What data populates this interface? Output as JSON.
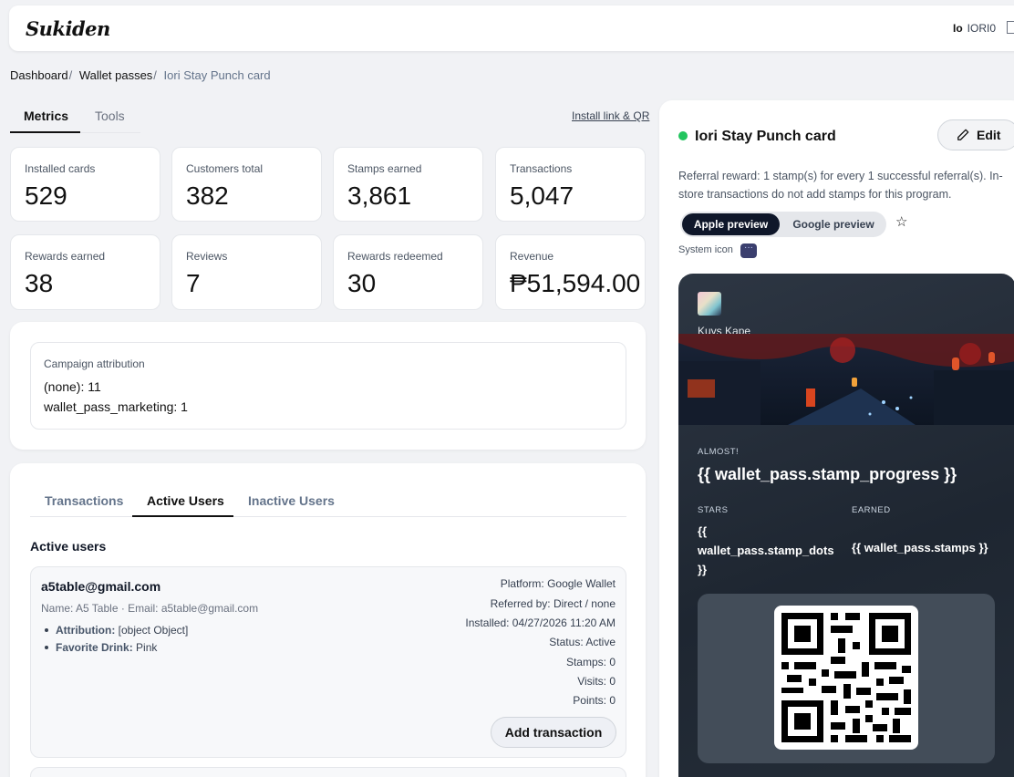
{
  "app": {
    "logo": "Sukiden"
  },
  "user": {
    "initials": "Io",
    "name": "IORI0"
  },
  "breadcrumb": {
    "dashboard": "Dashboard",
    "wallet_passes": "Wallet passes",
    "current": "Iori Stay Punch card",
    "sep": "/"
  },
  "tabs": {
    "metrics": "Metrics",
    "tools": "Tools"
  },
  "install_link": "Install link & QR",
  "metrics": {
    "installed_label": "Installed cards",
    "installed_value": "529",
    "customers_label": "Customers total",
    "customers_value": "382",
    "stamps_label": "Stamps earned",
    "stamps_value": "3,861",
    "transactions_label": "Transactions",
    "transactions_value": "5,047",
    "rewards_label": "Rewards earned",
    "rewards_value": "38",
    "reviews_label": "Reviews",
    "reviews_value": "7",
    "redeemed_label": "Rewards redeemed",
    "redeemed_value": "30",
    "revenue_label": "Revenue",
    "revenue_value": "₱51,594.00"
  },
  "attribution": {
    "title": "Campaign attribution",
    "line1": "(none): 11",
    "line2": "wallet_pass_marketing: 1"
  },
  "user_tabs": {
    "transactions": "Transactions",
    "active": "Active Users",
    "inactive": "Inactive Users"
  },
  "active_users": {
    "title": "Active users",
    "user1": {
      "email": "a5table@gmail.com",
      "sub": "Name: A5 Table · Email: a5table@gmail.com",
      "attr_key": "Attribution:",
      "attr_val": " [object Object]",
      "drink_key": "Favorite Drink:",
      "drink_val": " Pink",
      "platform": "Platform: Google Wallet",
      "referred": "Referred by: Direct / none",
      "installed": "Installed: 04/27/2026 11:20 AM",
      "status": "Status: Active",
      "stamps": "Stamps: 0",
      "visits": "Visits: 0",
      "points": "Points: 0",
      "add_btn": "Add transaction"
    }
  },
  "preview": {
    "title": "Iori Stay Punch card",
    "edit": "Edit",
    "referral": "Referral reward: 1 stamp(s) for every 1 successful referral(s). In-store transactions do not add stamps for this program.",
    "apple": "Apple preview",
    "google": "Google preview",
    "system_icon": "System icon",
    "status_color": "#22c55e"
  },
  "pass": {
    "logo_text": "Kuys Kape",
    "almost": "ALMOST!",
    "progress": "{{ wallet_pass.stamp_progress }}",
    "stars_label": "STARS",
    "earned_label": "EARNED",
    "stars_value": "{{ wallet_pass.stamp_dots }}",
    "earned_value": "{{ wallet_pass.stamps }}"
  }
}
